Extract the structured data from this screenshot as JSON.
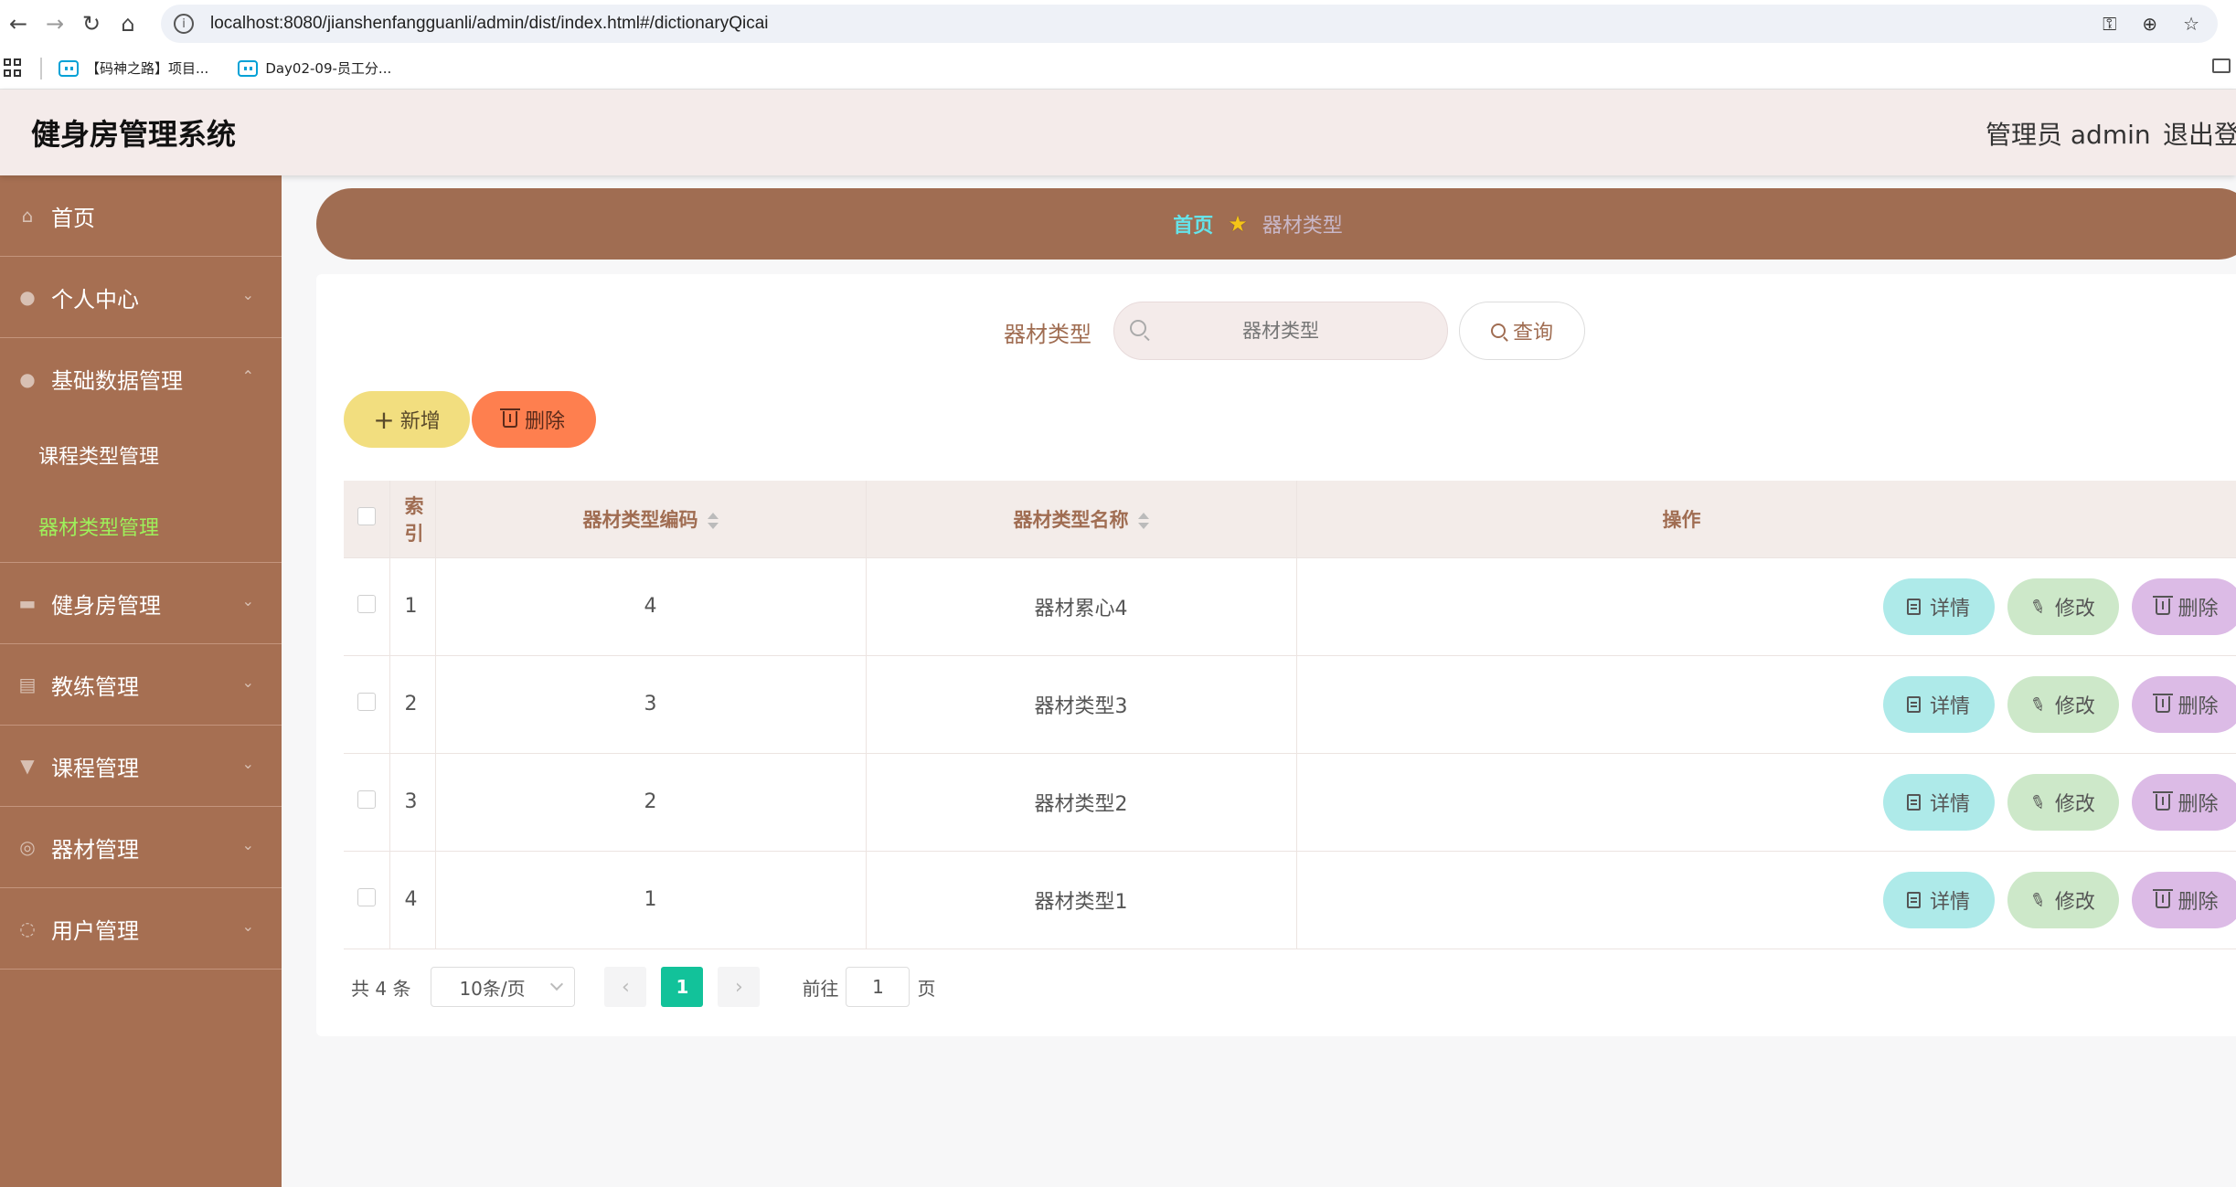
{
  "browser": {
    "url": "localhost:8080/jianshenfangguanli/admin/dist/index.html#/dictionaryQicai",
    "bookmarks": [
      "【码神之路】项目...",
      "Day02-09-员工分..."
    ]
  },
  "header": {
    "app_title": "健身房管理系统",
    "admin_label": "管理员 admin",
    "logout_label": "退出登录"
  },
  "sidebar": {
    "items": [
      {
        "label": "首页"
      },
      {
        "label": "个人中心"
      },
      {
        "label": "基础数据管理"
      },
      {
        "label": "健身房管理"
      },
      {
        "label": "教练管理"
      },
      {
        "label": "课程管理"
      },
      {
        "label": "器材管理"
      },
      {
        "label": "用户管理"
      }
    ],
    "sub_items": [
      {
        "label": "课程类型管理"
      },
      {
        "label": "器材类型管理"
      }
    ]
  },
  "breadcrumb": {
    "home": "首页",
    "current": "器材类型"
  },
  "search": {
    "label": "器材类型",
    "placeholder": "器材类型",
    "query_label": "查询"
  },
  "actions": {
    "add_label": "新增",
    "delete_label": "删除"
  },
  "table": {
    "headers": [
      "索引",
      "器材类型编码",
      "器材类型名称",
      "操作"
    ],
    "rows": [
      {
        "index": "1",
        "code": "4",
        "name": "器材累心4"
      },
      {
        "index": "2",
        "code": "3",
        "name": "器材类型3"
      },
      {
        "index": "3",
        "code": "2",
        "name": "器材类型2"
      },
      {
        "index": "4",
        "code": "1",
        "name": "器材类型1"
      }
    ],
    "row_actions": {
      "detail": "详情",
      "edit": "修改",
      "remove": "删除"
    }
  },
  "pagination": {
    "total_text": "共 4 条",
    "page_size": "10条/页",
    "current_page": "1",
    "goto_label": "前往",
    "goto_value": "1",
    "page_suffix": "页"
  },
  "colors": {
    "sidebar_bg": "#a66f52",
    "active_menu": "#9ef05a",
    "accent_green": "#12c29a"
  }
}
